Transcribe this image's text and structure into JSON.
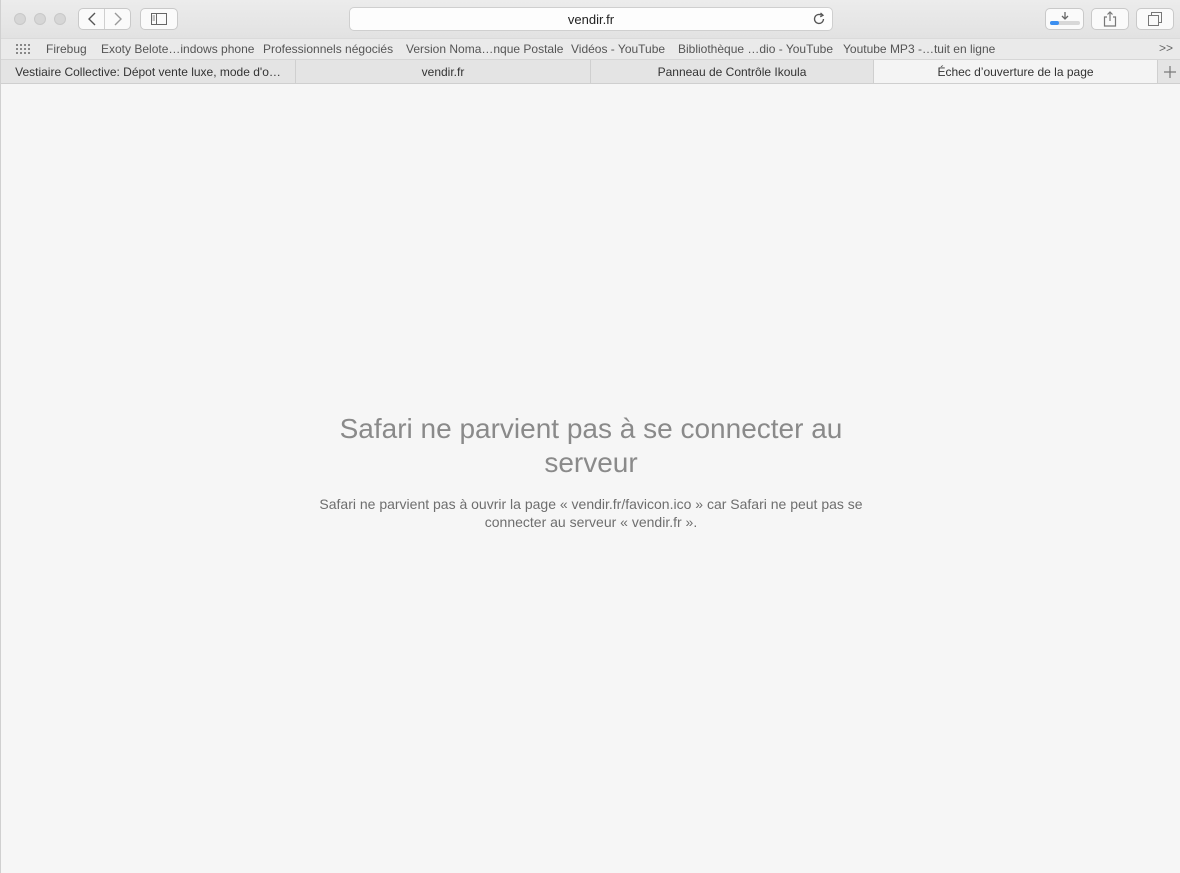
{
  "window": {
    "controls": [
      "close",
      "minimize",
      "zoom"
    ]
  },
  "toolbar": {
    "address": "vendir.fr",
    "icons": {
      "back": "chevron-left-icon",
      "forward": "chevron-right-icon",
      "sidebar": "sidebar-icon",
      "reload": "reload-icon",
      "downloads": "download-icon",
      "share": "share-icon",
      "tabs": "tabs-overview-icon"
    },
    "download_progress": 0.3
  },
  "bookmarks": {
    "items": [
      "Firebug",
      "Exoty Belote…indows phone",
      "Professionnels négociés",
      "Version Noma…nque Postale",
      "Vidéos - YouTube",
      "Bibliothèque …dio - YouTube",
      "Youtube MP3 -…tuit en ligne"
    ],
    "more": ">>"
  },
  "tabs": [
    {
      "label": "Vestiaire Collective: Dépot vente luxe, mode d'o…",
      "active": false
    },
    {
      "label": "vendir.fr",
      "active": false
    },
    {
      "label": "Panneau de Contrôle Ikoula",
      "active": false
    },
    {
      "label": "Échec d’ouverture de la page",
      "active": true
    }
  ],
  "error": {
    "title": "Safari ne parvient pas à se connecter au serveur",
    "message": "Safari ne parvient pas à ouvrir la page « vendir.fr/favicon.ico » car Safari ne peut pas se connecter au serveur « vendir.fr »."
  }
}
